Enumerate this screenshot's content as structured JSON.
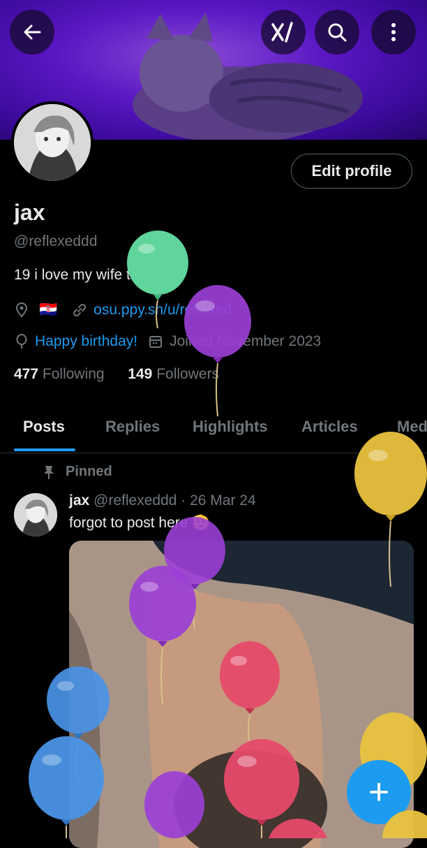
{
  "profile": {
    "name": "jax",
    "handle": "@reflexeddd",
    "bio": "19 i love my wife to death",
    "flag": "🇭🇷",
    "link": "osu.ppy.sh/u/reflexed",
    "birthday": "Happy birthday!",
    "joined": "Joined November 2023",
    "following_count": "477",
    "following_label": "Following",
    "followers_count": "149",
    "followers_label": "Followers"
  },
  "header": {
    "back_icon": "back-arrow-icon",
    "grok_icon": "grok-icon",
    "search_icon": "search-icon",
    "more_icon": "more-vertical-icon"
  },
  "edit_profile_label": "Edit profile",
  "tabs": [
    {
      "label": "Posts",
      "active": true
    },
    {
      "label": "Replies"
    },
    {
      "label": "Highlights"
    },
    {
      "label": "Articles"
    },
    {
      "label": "Med"
    }
  ],
  "pinned_post": {
    "pinned_label": "Pinned",
    "author": "jax",
    "handle": "@reflexeddd",
    "date": "· 26 Mar 24",
    "text": "forgot to post here",
    "emoji": "🫡"
  },
  "fab_label": "+",
  "colors": {
    "accent": "#1d9bf0",
    "balloon_green": "#5fd49b",
    "balloon_purple": "#9b3fd6",
    "balloon_yellow": "#e9c23e",
    "balloon_red": "#e64a6a",
    "balloon_blue": "#4a93e6"
  }
}
